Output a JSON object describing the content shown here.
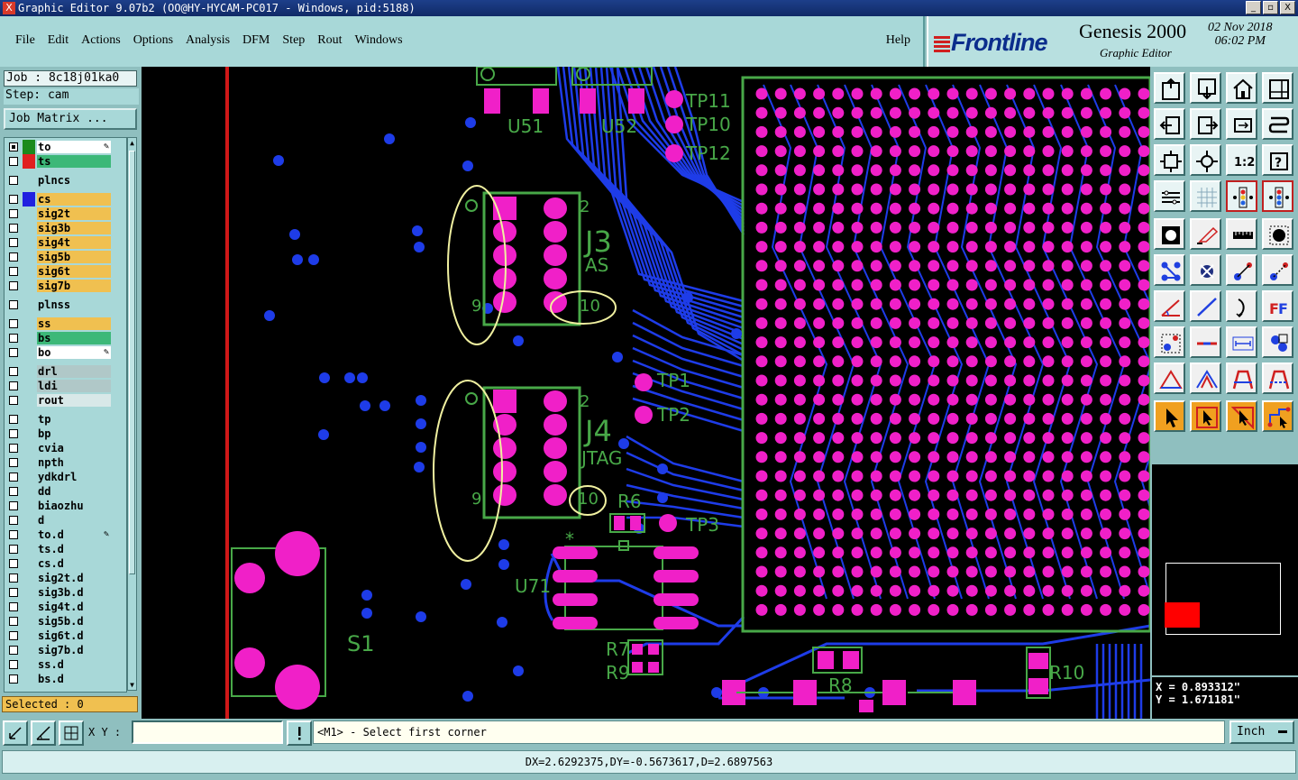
{
  "window": {
    "title": "Graphic Editor 9.07b2 (OO@HY-HYCAM-PC017 - Windows, pid:5188)",
    "app_icon": "x-icon",
    "buttons": [
      "_",
      "▫",
      "X"
    ]
  },
  "menu": {
    "items": [
      "File",
      "Edit",
      "Actions",
      "Options",
      "Analysis",
      "DFM",
      "Step",
      "Rout",
      "Windows"
    ],
    "help": "Help"
  },
  "brand": {
    "logo": "Frontline",
    "product": "Genesis 2000",
    "subtitle": "Graphic Editor",
    "date": "02 Nov 2018",
    "time": "06:02 PM"
  },
  "job": {
    "job_label": "Job : 8c18j01ka0",
    "step_label": "Step: cam",
    "matrix_button": "Job Matrix ..."
  },
  "layers": [
    {
      "name": "to",
      "color": "#ffffff",
      "swatch": "#1c8a1c",
      "checked": true,
      "edit": true
    },
    {
      "name": "ts",
      "color": "#3cb878",
      "swatch": "#e02020",
      "checked": false
    },
    {
      "name": "plncs",
      "color": "#a8d8d8",
      "checked": false
    },
    {
      "name": "cs",
      "color": "#f0c050",
      "swatch": "#2020e0",
      "checked": false
    },
    {
      "name": "sig2t",
      "color": "#f0c050",
      "checked": false
    },
    {
      "name": "sig3b",
      "color": "#f0c050",
      "checked": false
    },
    {
      "name": "sig4t",
      "color": "#f0c050",
      "checked": false
    },
    {
      "name": "sig5b",
      "color": "#f0c050",
      "checked": false
    },
    {
      "name": "sig6t",
      "color": "#f0c050",
      "checked": false
    },
    {
      "name": "sig7b",
      "color": "#f0c050",
      "checked": false
    },
    {
      "name": "plnss",
      "color": "#a8d8d8",
      "checked": false
    },
    {
      "name": "ss",
      "color": "#f0c050",
      "checked": false
    },
    {
      "name": "bs",
      "color": "#3cb878",
      "checked": false
    },
    {
      "name": "bo",
      "color": "#ffffff",
      "checked": false,
      "edit": true
    },
    {
      "name": "drl",
      "color": "#b0c8c8",
      "checked": false
    },
    {
      "name": "ldi",
      "color": "#b0c8c8",
      "checked": false
    },
    {
      "name": "rout",
      "color": "#d8e8e8",
      "checked": false
    },
    {
      "name": "tp",
      "color": "#a8d8d8",
      "checked": false
    },
    {
      "name": "bp",
      "color": "#a8d8d8",
      "checked": false
    },
    {
      "name": "cvia",
      "color": "#a8d8d8",
      "checked": false
    },
    {
      "name": "npth",
      "color": "#a8d8d8",
      "checked": false
    },
    {
      "name": "ydkdrl",
      "color": "#a8d8d8",
      "checked": false
    },
    {
      "name": "dd",
      "color": "#a8d8d8",
      "checked": false
    },
    {
      "name": "biaozhu",
      "color": "#a8d8d8",
      "checked": false
    },
    {
      "name": "d",
      "color": "#a8d8d8",
      "checked": false
    },
    {
      "name": "to.d",
      "color": "#a8d8d8",
      "checked": false,
      "edit": true
    },
    {
      "name": "ts.d",
      "color": "#a8d8d8",
      "checked": false
    },
    {
      "name": "cs.d",
      "color": "#a8d8d8",
      "checked": false
    },
    {
      "name": "sig2t.d",
      "color": "#a8d8d8",
      "checked": false
    },
    {
      "name": "sig3b.d",
      "color": "#a8d8d8",
      "checked": false
    },
    {
      "name": "sig4t.d",
      "color": "#a8d8d8",
      "checked": false
    },
    {
      "name": "sig5b.d",
      "color": "#a8d8d8",
      "checked": false
    },
    {
      "name": "sig6t.d",
      "color": "#a8d8d8",
      "checked": false
    },
    {
      "name": "sig7b.d",
      "color": "#a8d8d8",
      "checked": false
    },
    {
      "name": "ss.d",
      "color": "#a8d8d8",
      "checked": false
    },
    {
      "name": "bs.d",
      "color": "#a8d8d8",
      "checked": false
    }
  ],
  "selected_label": "Selected : 0",
  "canvas_labels": {
    "u51": "U51",
    "u52": "U52",
    "tp11": "TP11",
    "tp10": "TP10",
    "tp12": "TP12",
    "j3": "J3",
    "as": "AS",
    "j3_pin2": "2",
    "j3_pin9": "9",
    "j3_pin10": "10",
    "tp1": "TP1",
    "tp2": "TP2",
    "j4": "J4",
    "jtag": "JTAG",
    "j4_pin2": "2",
    "j4_pin9": "9",
    "j4_pin10": "10",
    "r6": "R6",
    "tp3": "TP3",
    "u71": "U71",
    "s1": "S1",
    "r7": "R7",
    "r9": "R9",
    "r8": "R8",
    "r10": "R10",
    "star": "*"
  },
  "colors": {
    "pad": "#f020c8",
    "trace": "#1e3ce8",
    "outline": "#48a848",
    "board_edge": "#d01818",
    "highlight": "#f0f0a0"
  },
  "tools": [
    "top-frame-icon",
    "bottom-frame-icon",
    "home-icon",
    "split-view-icon",
    "left-frame-icon",
    "right-frame-icon",
    "pan-icon",
    "snake-icon",
    "fit-all-icon",
    "fit-icon",
    "scale-1-2-icon",
    "help-icon",
    "settings-icon",
    "grid-icon",
    "layer-colors-icon",
    "layer-colors-alt-icon",
    "pad-icon",
    "shape-icon",
    "ruler-icon",
    "circle-pad-icon",
    "net-icon",
    "cross-icon",
    "connect-icon",
    "connect-alt-icon",
    "line-angle-icon",
    "line-icon",
    "arc-icon",
    "font-icon",
    "feature-icon",
    "cut-icon",
    "measure-icon",
    "group-icon",
    "triangle-icon",
    "triangle-2-icon",
    "arch-icon",
    "arch-2-icon",
    "select-arrow-icon",
    "select-box-icon",
    "select-area-icon",
    "select-net-icon"
  ],
  "coords": {
    "x": "X = 0.893312\"",
    "y": "Y = 1.671181\""
  },
  "bottom": {
    "xy_label": "X Y :",
    "xy_value": "",
    "message": "<M1> - Select first corner",
    "unit": "Inch",
    "status": "DX=2.6292375,DY=-0.5673617,D=2.6897563"
  }
}
